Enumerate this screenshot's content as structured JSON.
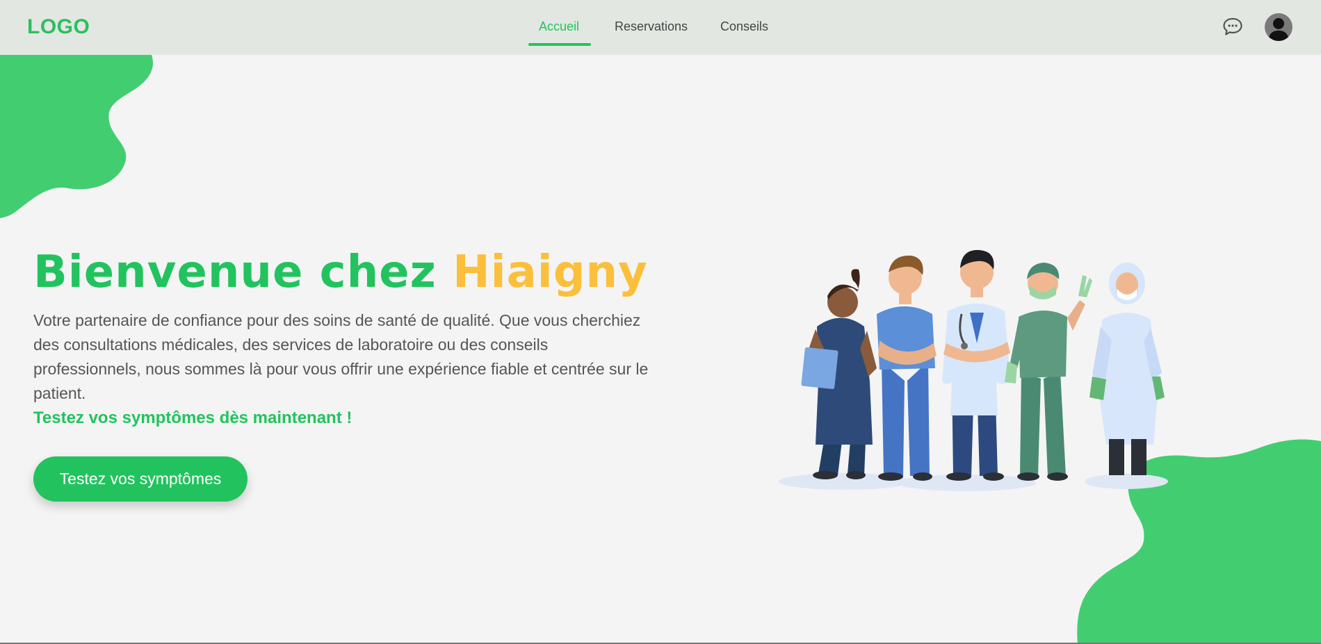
{
  "navbar": {
    "logo": "LOGO",
    "links": [
      {
        "label": "Accueil",
        "active": true
      },
      {
        "label": "Reservations",
        "active": false
      },
      {
        "label": "Conseils",
        "active": false
      }
    ],
    "chat_icon": "chat-bubble-icon",
    "avatar_icon": "user-avatar-icon"
  },
  "hero": {
    "title_prefix": "Bienvenue chez ",
    "title_brand": "Hiaigny",
    "description": "Votre partenaire de confiance pour des soins de santé de qualité. Que vous cherchiez des consultations médicales, des services de laboratoire ou des conseils professionnels, nous sommes là pour vous offrir une expérience fiable et centrée sur le patient.",
    "cta_text": "Testez vos symptômes dès maintenant !",
    "cta_button": "Testez vos symptômes"
  },
  "illustration": "healthcare-team-illustration",
  "colors": {
    "brand_green": "#22c35e",
    "accent_yellow": "#fbbf3c",
    "navbar_bg": "#e2e7e2",
    "blob_green": "#43cd71"
  }
}
